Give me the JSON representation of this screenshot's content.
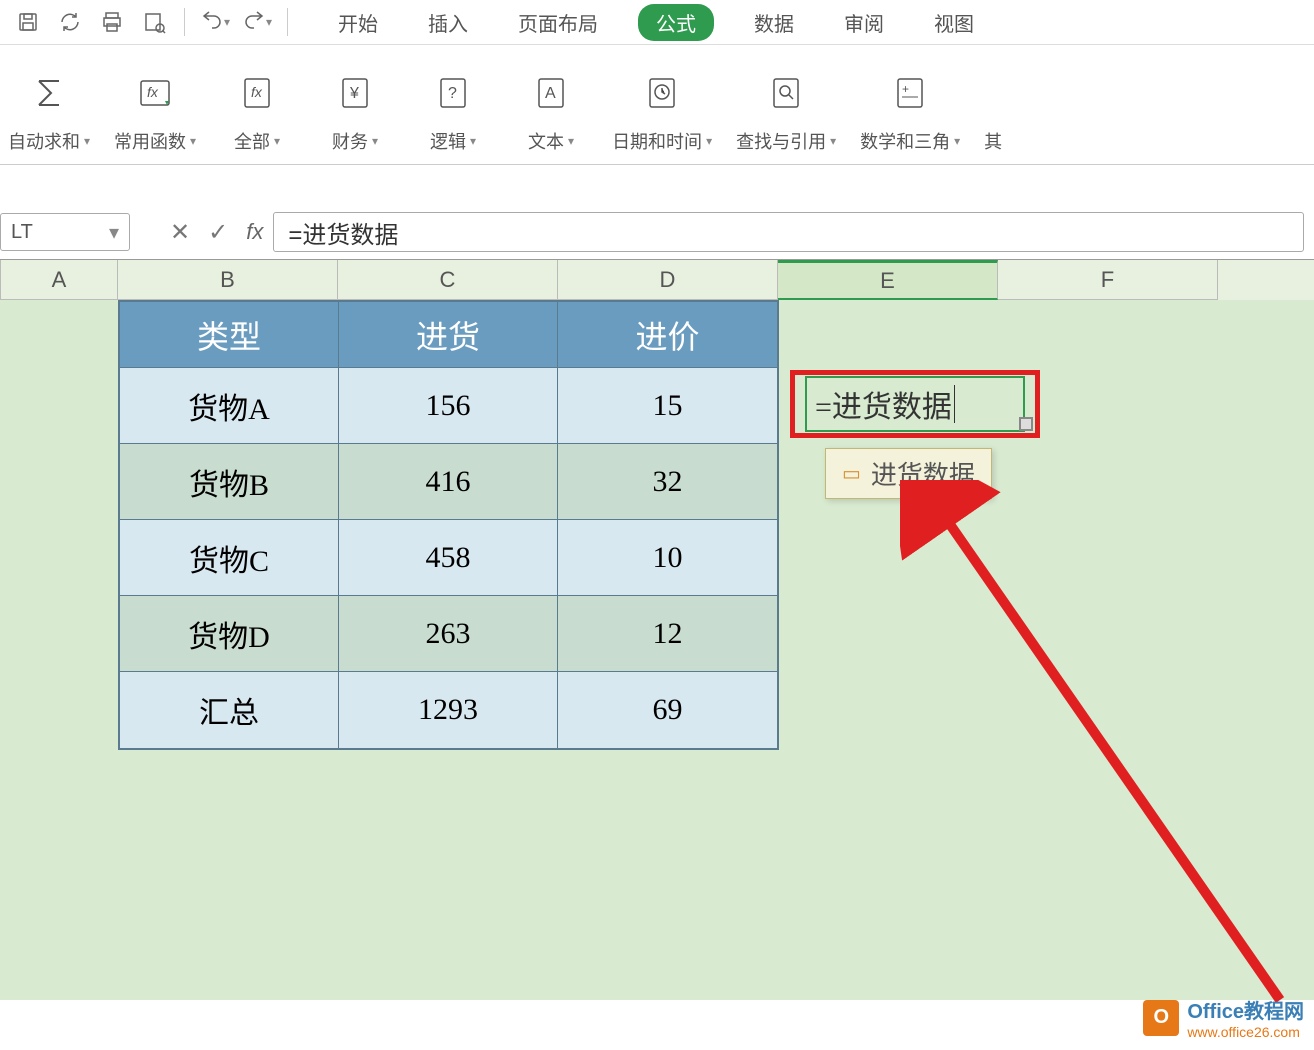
{
  "toolbar": {
    "menu_tabs": [
      "开始",
      "插入",
      "页面布局",
      "公式",
      "数据",
      "审阅",
      "视图"
    ],
    "active_tab": "公式"
  },
  "ribbon": {
    "items": [
      {
        "label": "自动求和",
        "icon": "sigma"
      },
      {
        "label": "常用函数",
        "icon": "fx-star"
      },
      {
        "label": "全部",
        "icon": "fx-book"
      },
      {
        "label": "财务",
        "icon": "yen-book"
      },
      {
        "label": "逻辑",
        "icon": "q-book"
      },
      {
        "label": "文本",
        "icon": "a-book"
      },
      {
        "label": "日期和时间",
        "icon": "clock-book"
      },
      {
        "label": "查找与引用",
        "icon": "mag-book"
      },
      {
        "label": "数学和三角",
        "icon": "plus-book"
      },
      {
        "label": "其"
      }
    ]
  },
  "formula_bar": {
    "name_box": "LT",
    "formula": "=进货数据"
  },
  "columns": [
    "A",
    "B",
    "C",
    "D",
    "E",
    "F"
  ],
  "table": {
    "headers": [
      "类型",
      "进货",
      "进价"
    ],
    "rows": [
      [
        "货物A",
        "156",
        "15"
      ],
      [
        "货物B",
        "416",
        "32"
      ],
      [
        "货物C",
        "458",
        "10"
      ],
      [
        "货物D",
        "263",
        "12"
      ],
      [
        "汇总",
        "1293",
        "69"
      ]
    ]
  },
  "cell_E2": "=进货数据",
  "tooltip": "进货数据",
  "watermark": {
    "title": "Office教程网",
    "url": "www.office26.com"
  },
  "chart_data": {
    "type": "table",
    "headers": [
      "类型",
      "进货",
      "进价"
    ],
    "rows": [
      {
        "类型": "货物A",
        "进货": 156,
        "进价": 15
      },
      {
        "类型": "货物B",
        "进货": 416,
        "进价": 32
      },
      {
        "类型": "货物C",
        "进货": 458,
        "进价": 10
      },
      {
        "类型": "货物D",
        "进货": 263,
        "进价": 12
      },
      {
        "类型": "汇总",
        "进货": 1293,
        "进价": 69
      }
    ]
  }
}
